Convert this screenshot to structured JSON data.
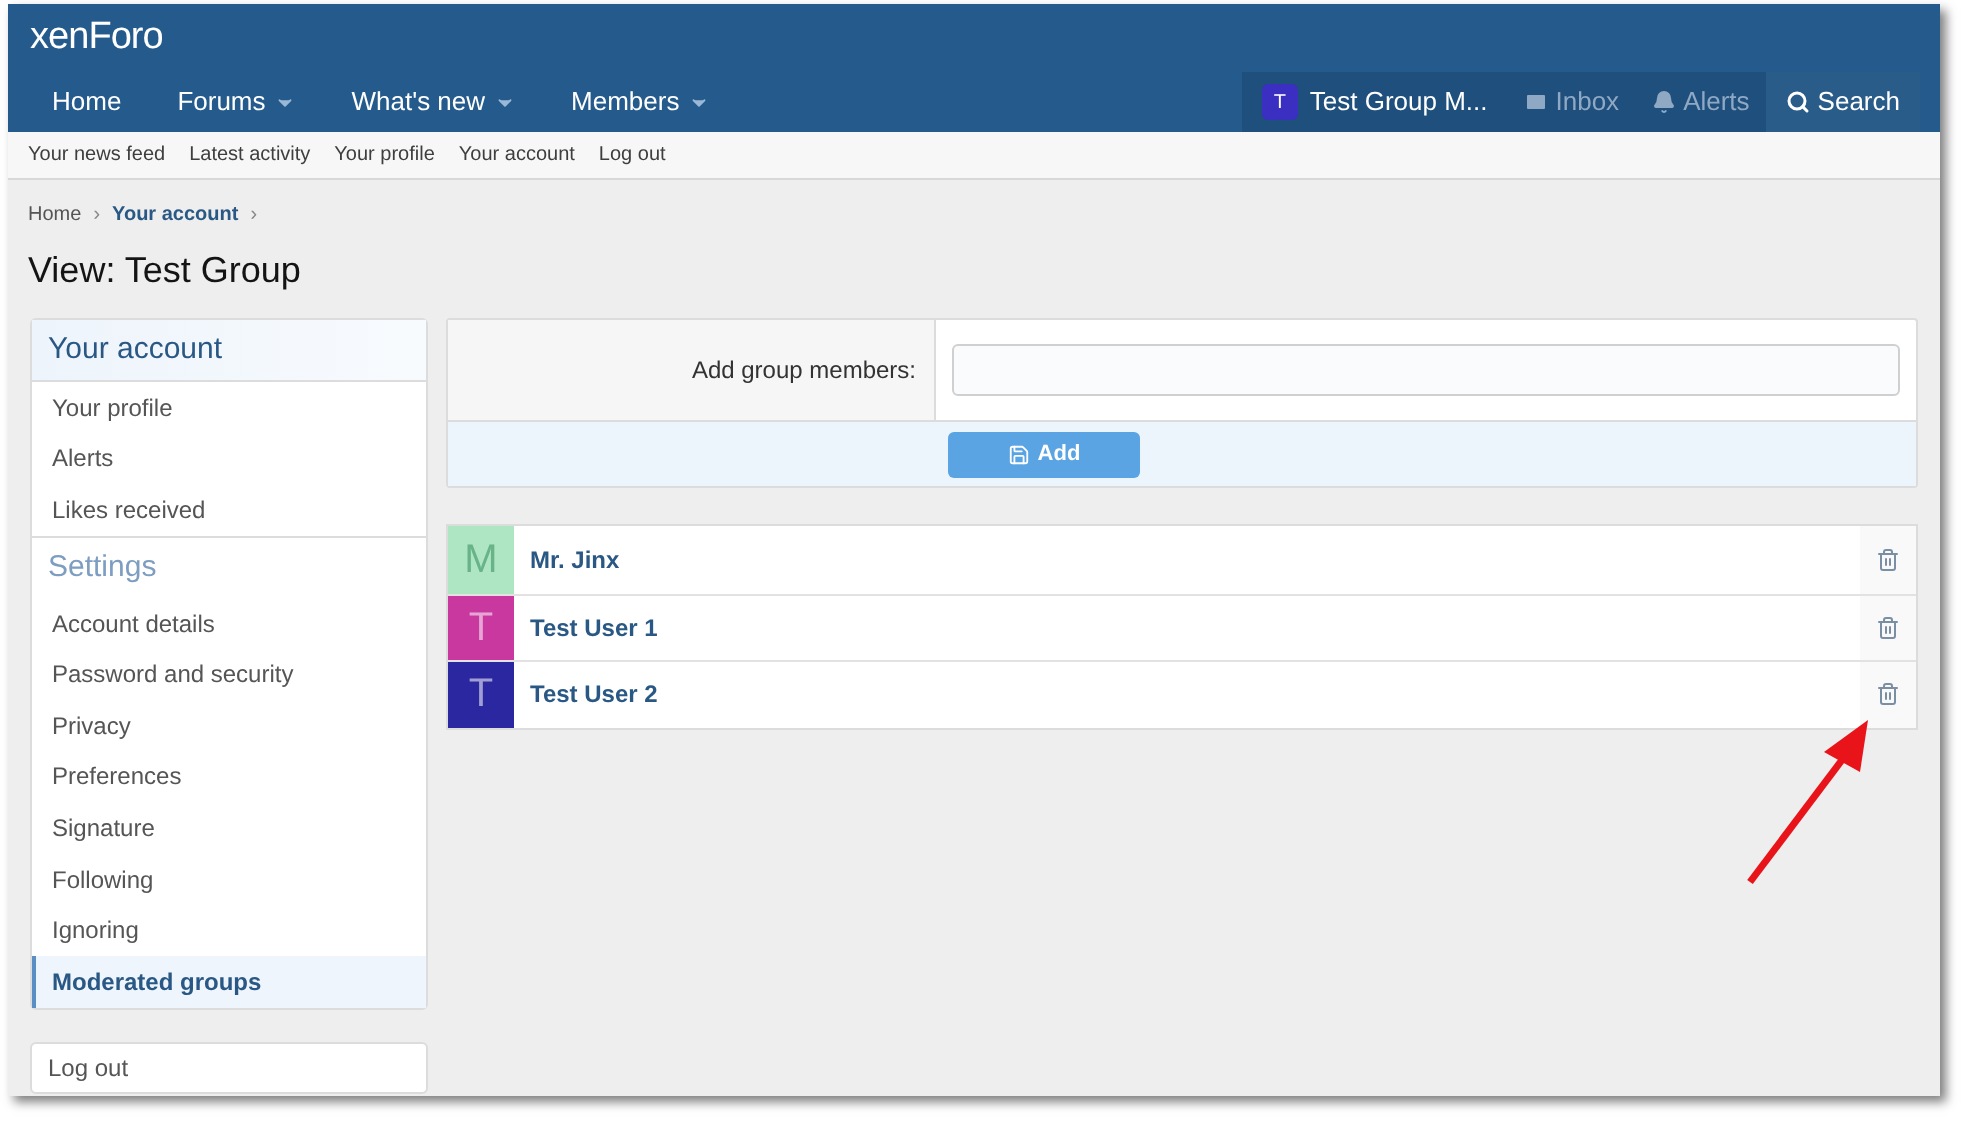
{
  "logo": "xenForo",
  "nav": [
    {
      "label": "Home",
      "caret": false
    },
    {
      "label": "Forums",
      "caret": true
    },
    {
      "label": "What's new",
      "caret": true
    },
    {
      "label": "Members",
      "caret": true
    }
  ],
  "user_nav": {
    "avatar_letter": "T",
    "username": "Test Group M...",
    "inbox": "Inbox",
    "alerts": "Alerts",
    "search": "Search"
  },
  "sub_nav": [
    "Your news feed",
    "Latest activity",
    "Your profile",
    "Your account",
    "Log out"
  ],
  "breadcrumbs": [
    {
      "label": "Home",
      "current": false,
      "separator": "›"
    },
    {
      "label": "Your account",
      "current": true,
      "separator": "›"
    }
  ],
  "page_title": "View: Test Group",
  "sidebar": {
    "sections": [
      {
        "title": "Your account",
        "items": [
          {
            "label": "Your profile",
            "selected": false
          },
          {
            "label": "Alerts",
            "selected": false
          },
          {
            "label": "Likes received",
            "selected": false
          }
        ]
      },
      {
        "title": "Settings",
        "items": [
          {
            "label": "Account details",
            "selected": false
          },
          {
            "label": "Password and security",
            "selected": false
          },
          {
            "label": "Privacy",
            "selected": false
          },
          {
            "label": "Preferences",
            "selected": false
          },
          {
            "label": "Signature",
            "selected": false
          },
          {
            "label": "Following",
            "selected": false
          },
          {
            "label": "Ignoring",
            "selected": false
          },
          {
            "label": "Moderated groups",
            "selected": true
          }
        ]
      }
    ],
    "logout": "Log out"
  },
  "form": {
    "label": "Add group members:",
    "button": "Add"
  },
  "members": [
    {
      "letter": "M",
      "name": "Mr. Jinx",
      "color": "#aee6c4"
    },
    {
      "letter": "T",
      "name": "Test User 1",
      "color": "#c8389f"
    },
    {
      "letter": "T",
      "name": "Test User 2",
      "color": "#2b27a0"
    }
  ]
}
